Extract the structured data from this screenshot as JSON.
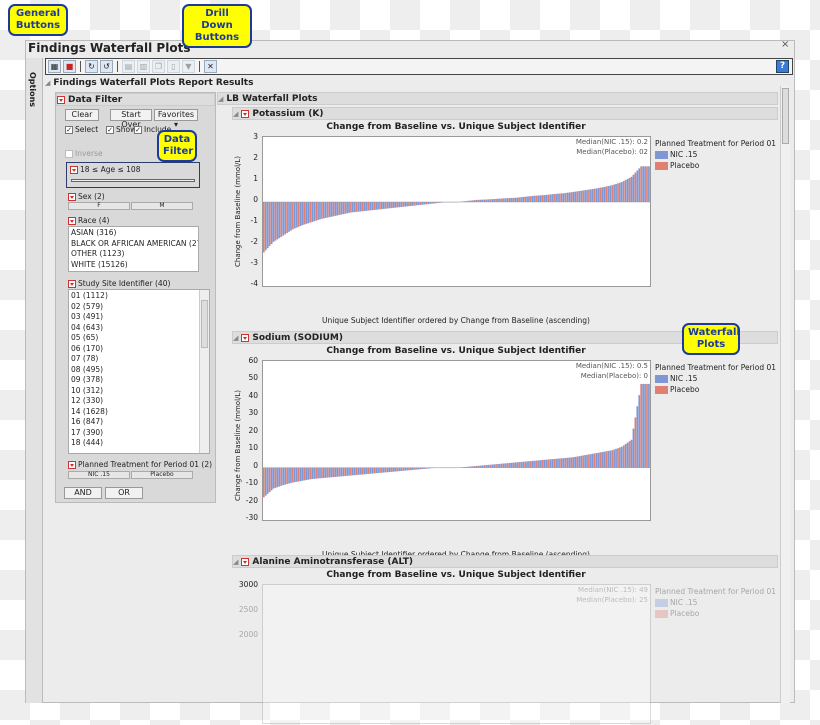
{
  "window": {
    "title": "Findings Waterfall Plots",
    "close": "×",
    "options_tab": "Options",
    "help": "?"
  },
  "callouts": {
    "general": "General Buttons",
    "drill": "Drill Down Buttons",
    "filter": "Data Filter",
    "waterfall": "Waterfall Plots"
  },
  "report": {
    "title": "Findings Waterfall Plots Report Results"
  },
  "filter": {
    "title": "Data Filter",
    "clear": "Clear",
    "start_over": "Start Over",
    "favorites": "Favorites ▾",
    "select": "Select",
    "show": "Show",
    "include": "Include",
    "inverse": "Inverse",
    "age": "18 ≤ Age ≤ 108",
    "sex_title": "Sex (2)",
    "sex": [
      "F",
      "M"
    ],
    "race_title": "Race (4)",
    "race": [
      "ASIAN (316)",
      "BLACK OR AFRICAN AMERICAN (2714",
      "OTHER (1123)",
      "WHITE (15126)"
    ],
    "site_title": "Study Site Identifier (40)",
    "sites": [
      "01 (1112)",
      "02 (579)",
      "03 (491)",
      "04 (643)",
      "05 (65)",
      "06 (170)",
      "07 (78)",
      "08 (495)",
      "09 (378)",
      "10 (312)",
      "12 (330)",
      "14 (1628)",
      "16 (847)",
      "17 (390)",
      "18 (444)"
    ],
    "trt_title": "Planned Treatment for Period 01 (2)",
    "trt": [
      "NIC .15",
      "Placebo"
    ],
    "and": "AND",
    "or": "OR"
  },
  "lb": {
    "title": "LB Waterfall Plots"
  },
  "colors": {
    "nic": "#7f98d4",
    "placebo": "#e07f72"
  },
  "chart_data": [
    {
      "type": "bar",
      "section": "Potassium (K)",
      "title": "Change from Baseline vs. Unique Subject Identifier",
      "xlabel": "Unique Subject Identifier ordered by Change from Baseline (ascending)",
      "ylabel": "Change from Baseline (mmol/L)",
      "ylim": [
        -4,
        3
      ],
      "yticks": [
        "3",
        "2",
        "1",
        "0",
        "-1",
        "-2",
        "-3",
        "-4"
      ],
      "medians": [
        "Median(NIC .15): 0.2",
        "Median(Placebo): 02"
      ],
      "legend_title": "Planned Treatment for Period 01",
      "legend": [
        "NIC .15",
        "Placebo"
      ],
      "values": [
        -2.4,
        -1.9,
        -1.6,
        -1.3,
        -1.1,
        -0.95,
        -0.8,
        -0.7,
        -0.6,
        -0.5,
        -0.45,
        -0.4,
        -0.35,
        -0.3,
        -0.25,
        -0.2,
        -0.15,
        -0.1,
        -0.05,
        0,
        0,
        0.05,
        0.1,
        0.12,
        0.15,
        0.18,
        0.2,
        0.25,
        0.3,
        0.33,
        0.38,
        0.42,
        0.48,
        0.55,
        0.62,
        0.7,
        0.8,
        0.95,
        1.2,
        1.7
      ]
    },
    {
      "type": "bar",
      "section": "Sodium (SODIUM)",
      "title": "Change from Baseline vs. Unique Subject Identifier",
      "xlabel": "Unique Subject Identifier ordered by Change from Baseline (ascending)",
      "ylabel": "Change from Baseline (mmol/L)",
      "ylim": [
        -30,
        60
      ],
      "yticks": [
        "60",
        "50",
        "40",
        "30",
        "20",
        "10",
        "0",
        "-10",
        "-20",
        "-30"
      ],
      "medians": [
        "Median(NIC .15): 0.5",
        "Median(Placebo): 0"
      ],
      "legend_title": "Planned Treatment for Period 01",
      "legend": [
        "NIC .15",
        "Placebo"
      ],
      "values": [
        -17,
        -12,
        -10,
        -8.5,
        -7.5,
        -6.5,
        -6,
        -5.5,
        -5,
        -4.5,
        -4,
        -3.5,
        -3,
        -2.5,
        -2,
        -1.5,
        -1,
        -0.5,
        0,
        0,
        0,
        0.5,
        1,
        1.5,
        2,
        2.5,
        3,
        3.5,
        4,
        4.5,
        5,
        5.5,
        6,
        7,
        8,
        9,
        10,
        12,
        16,
        48
      ]
    },
    {
      "type": "bar",
      "section": "Alanine Aminotransferase (ALT)",
      "title": "Change from Baseline vs. Unique Subject Identifier",
      "yticks": [
        "3000",
        "2500",
        "2000"
      ],
      "medians": [
        "Median(NIC .15): 49",
        "Median(Placebo): 25"
      ],
      "legend_title": "Planned Treatment for Period 01",
      "legend": [
        "NIC .15",
        "Placebo"
      ]
    }
  ]
}
